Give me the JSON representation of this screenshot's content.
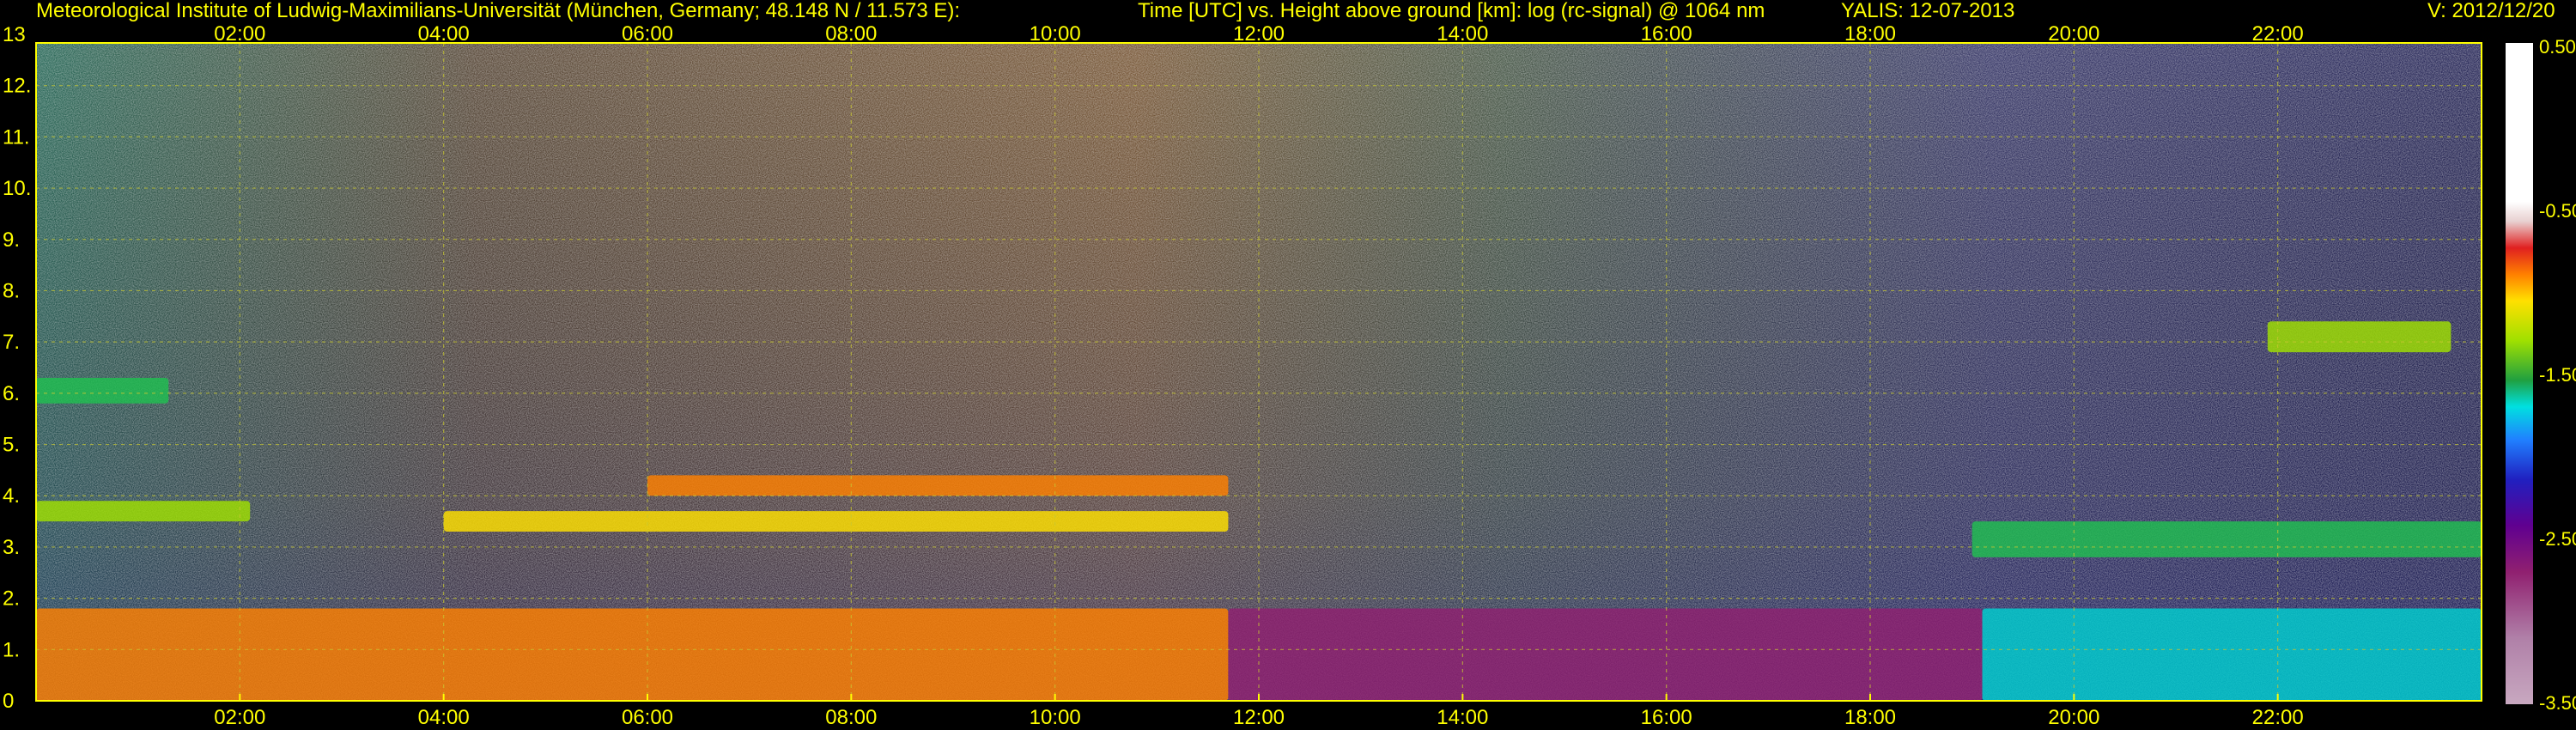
{
  "header": {
    "institute": "Meteorological Institute of Ludwig-Maximilians-Universität (München, Germany; 48.148 N / 11.573 E):",
    "title": "Time [UTC] vs. Height above ground [km]: log (rc-signal) @ 1064 nm",
    "instrument": "YALIS: 12-07-2013",
    "version": "V: 2012/12/20"
  },
  "colors": {
    "background": "#000000",
    "text": "#ffff00",
    "grid": "#c8c832"
  },
  "chart_data": {
    "type": "heatmap",
    "title": "Time [UTC] vs. Height above ground [km]: log (rc-signal) @ 1064 nm",
    "xlabel": "",
    "ylabel": "",
    "x_unit": "hours UTC",
    "xlim": [
      0,
      24
    ],
    "ylim": [
      0,
      13
    ],
    "x_ticks": [
      2,
      4,
      6,
      8,
      10,
      12,
      14,
      16,
      18,
      20,
      22
    ],
    "x_tick_labels": [
      "02:00",
      "04:00",
      "06:00",
      "08:00",
      "10:00",
      "12:00",
      "14:00",
      "16:00",
      "18:00",
      "20:00",
      "22:00"
    ],
    "y_ticks": [
      0,
      1,
      2,
      3,
      4,
      5,
      6,
      7,
      8,
      9,
      10,
      11,
      12,
      13
    ],
    "y_tick_labels": [
      "0",
      "1.",
      "2.",
      "3.",
      "4.",
      "5.",
      "6.",
      "7.",
      "8.",
      "9.",
      "10.",
      "11.",
      "12.",
      "13"
    ],
    "grid": true,
    "colorbar": {
      "range": [
        -3.5,
        0.5
      ],
      "ticks": [
        0.5,
        -0.5,
        -1.5,
        -2.5,
        -3.5
      ],
      "tick_labels": [
        "0.50",
        "-0.50",
        "-1.50",
        "-2.50",
        "-3.50"
      ]
    },
    "layers": [
      {
        "feature": "boundary layer aerosol",
        "t_start": 0,
        "t_end": 11.7,
        "h_bottom": 0,
        "h_top": 1.8,
        "signal": -0.9
      },
      {
        "feature": "boundary layer aerosol",
        "t_start": 11.7,
        "t_end": 19.1,
        "h_bottom": 0,
        "h_top": 1.8,
        "signal": -2.8
      },
      {
        "feature": "boundary layer aerosol",
        "t_start": 19.1,
        "t_end": 24,
        "h_bottom": 0,
        "h_top": 1.8,
        "signal": -1.7
      },
      {
        "feature": "aerosol layer",
        "t_start": 0,
        "t_end": 2.1,
        "h_bottom": 3.5,
        "h_top": 3.9,
        "signal": -1.4
      },
      {
        "feature": "aerosol layer",
        "t_start": 4,
        "t_end": 11.7,
        "h_bottom": 3.3,
        "h_top": 3.7,
        "signal": -1.2
      },
      {
        "feature": "aerosol layer",
        "t_start": 6,
        "t_end": 11.7,
        "h_bottom": 4.0,
        "h_top": 4.4,
        "signal": -1.0
      },
      {
        "feature": "aerosol layer",
        "t_start": 0,
        "t_end": 1.3,
        "h_bottom": 5.8,
        "h_top": 6.3,
        "signal": -1.6
      },
      {
        "feature": "aerosol layer",
        "t_start": 19,
        "t_end": 24,
        "h_bottom": 2.8,
        "h_top": 3.5,
        "signal": -1.6
      },
      {
        "feature": "aerosol layer",
        "t_start": 21.9,
        "t_end": 23.7,
        "h_bottom": 6.8,
        "h_top": 7.4,
        "signal": -1.4
      }
    ]
  }
}
